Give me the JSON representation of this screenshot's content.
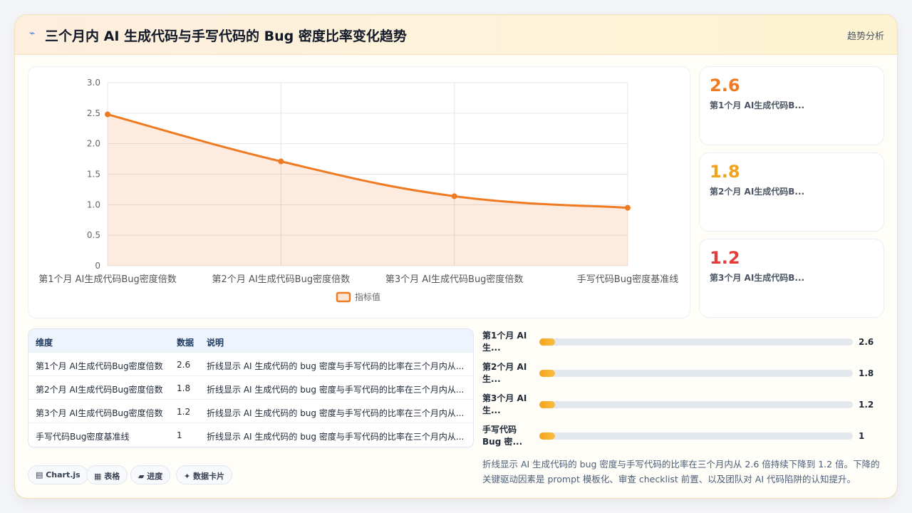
{
  "header": {
    "icon": "chart-line-icon",
    "title": "三个月内 AI 生成代码与手写代码的 Bug 密度比率变化趋势",
    "tag": "趋势分析"
  },
  "chart_data": {
    "type": "area",
    "categories": [
      "第1个月 AI生成代码Bug密度倍数",
      "第2个月 AI生成代码Bug密度倍数",
      "第3个月 AI生成代码Bug密度倍数",
      "手写代码Bug密度基准线"
    ],
    "series": [
      {
        "name": "指标值",
        "values": [
          2.48,
          1.71,
          1.14,
          0.95
        ]
      }
    ],
    "yticks": [
      "0",
      "0.5",
      "1.0",
      "1.5",
      "2.0",
      "2.5",
      "3.0"
    ],
    "ylim": [
      0,
      3
    ],
    "grid": true,
    "legend": "bottom",
    "color": "#ee7b22"
  },
  "kpis": [
    {
      "value": "2.6",
      "label": "第1个月 AI生成代码B...",
      "color": "#ee7b22"
    },
    {
      "value": "1.8",
      "label": "第2个月 AI生成代码B...",
      "color": "#f0a41c"
    },
    {
      "value": "1.2",
      "label": "第3个月 AI生成代码B...",
      "color": "#e23d3d"
    }
  ],
  "table": {
    "headers": [
      "维度",
      "数据",
      "说明"
    ],
    "rows": [
      [
        "第1个月 AI生成代码Bug密度倍数",
        "2.6",
        "折线显示 AI 生成代码的 bug 密度与手写代码的比率在三个月内从..."
      ],
      [
        "第2个月 AI生成代码Bug密度倍数",
        "1.8",
        "折线显示 AI 生成代码的 bug 密度与手写代码的比率在三个月内从..."
      ],
      [
        "第3个月 AI生成代码Bug密度倍数",
        "1.2",
        "折线显示 AI 生成代码的 bug 密度与手写代码的比率在三个月内从..."
      ],
      [
        "手写代码Bug密度基准线",
        "1",
        "折线显示 AI 生成代码的 bug 密度与手写代码的比率在三个月内从..."
      ]
    ]
  },
  "progress": [
    {
      "label": "第1个月 AI 生...",
      "value": "2.6",
      "fraction": 0.05
    },
    {
      "label": "第2个月 AI 生...",
      "value": "1.8",
      "fraction": 0.05
    },
    {
      "label": "第3个月 AI 生...",
      "value": "1.2",
      "fraction": 0.05
    },
    {
      "label": "手写代码Bug 密...",
      "value": "1",
      "fraction": 0.05
    }
  ],
  "summary": "折线显示 AI 生成代码的 bug 密度与手写代码的比率在三个月内从 2.6 倍持续下降到 1.2 倍。下降的关键驱动因素是 prompt 模板化、审查 checklist 前置、以及团队对 AI 代码陷阱的认知提升。",
  "chips": [
    "▤ Chart.js",
    "▦ 表格",
    "▰ 进度",
    "✦ 数据卡片"
  ]
}
